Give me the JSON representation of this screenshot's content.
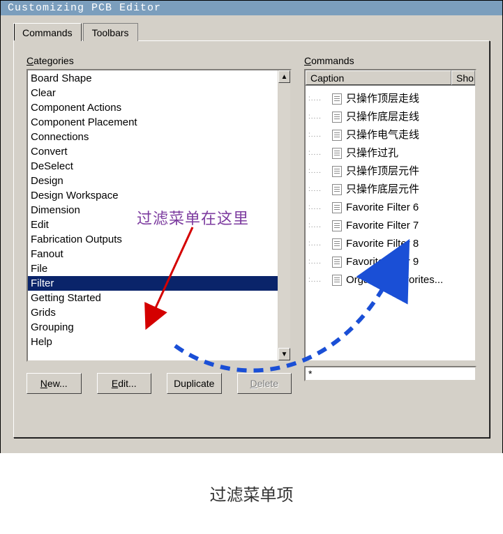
{
  "window": {
    "title": "Customizing PCB Editor"
  },
  "tabs": {
    "commands": "Commands",
    "toolbars": "Toolbars"
  },
  "labels": {
    "categories_pre": "C",
    "categories_rest": "ategories",
    "commands_pre": "C",
    "commands_rest": "ommands"
  },
  "categories": {
    "items": [
      "Board Shape",
      "Clear",
      "Component Actions",
      "Component Placement",
      "Connections",
      "Convert",
      "DeSelect",
      "Design",
      "Design Workspace",
      "Dimension",
      "Edit",
      "Fabrication Outputs",
      "Fanout",
      "File",
      "Filter",
      "Getting Started",
      "Grids",
      "Grouping",
      "Help"
    ],
    "selected_index": 14
  },
  "commands_panel": {
    "header_caption": "Caption",
    "header_shortcut": "Sho",
    "items": [
      "只操作顶层走线",
      "只操作底层走线",
      "只操作电气走线",
      "只操作过孔",
      "只操作顶层元件",
      "只操作底层元件",
      "Favorite Filter 6",
      "Favorite Filter 7",
      "Favorite Filter 8",
      "Favorite Filter 9",
      "Organize Favorites..."
    ],
    "search_value": "*"
  },
  "buttons": {
    "new": "New...",
    "new_ul": "N",
    "edit": "Edit...",
    "edit_ul": "E",
    "duplicate": "Duplicate",
    "delete": "Delete",
    "delete_ul": "D"
  },
  "annotation": {
    "text": "过滤菜单在这里"
  },
  "caption": "过滤菜单项"
}
